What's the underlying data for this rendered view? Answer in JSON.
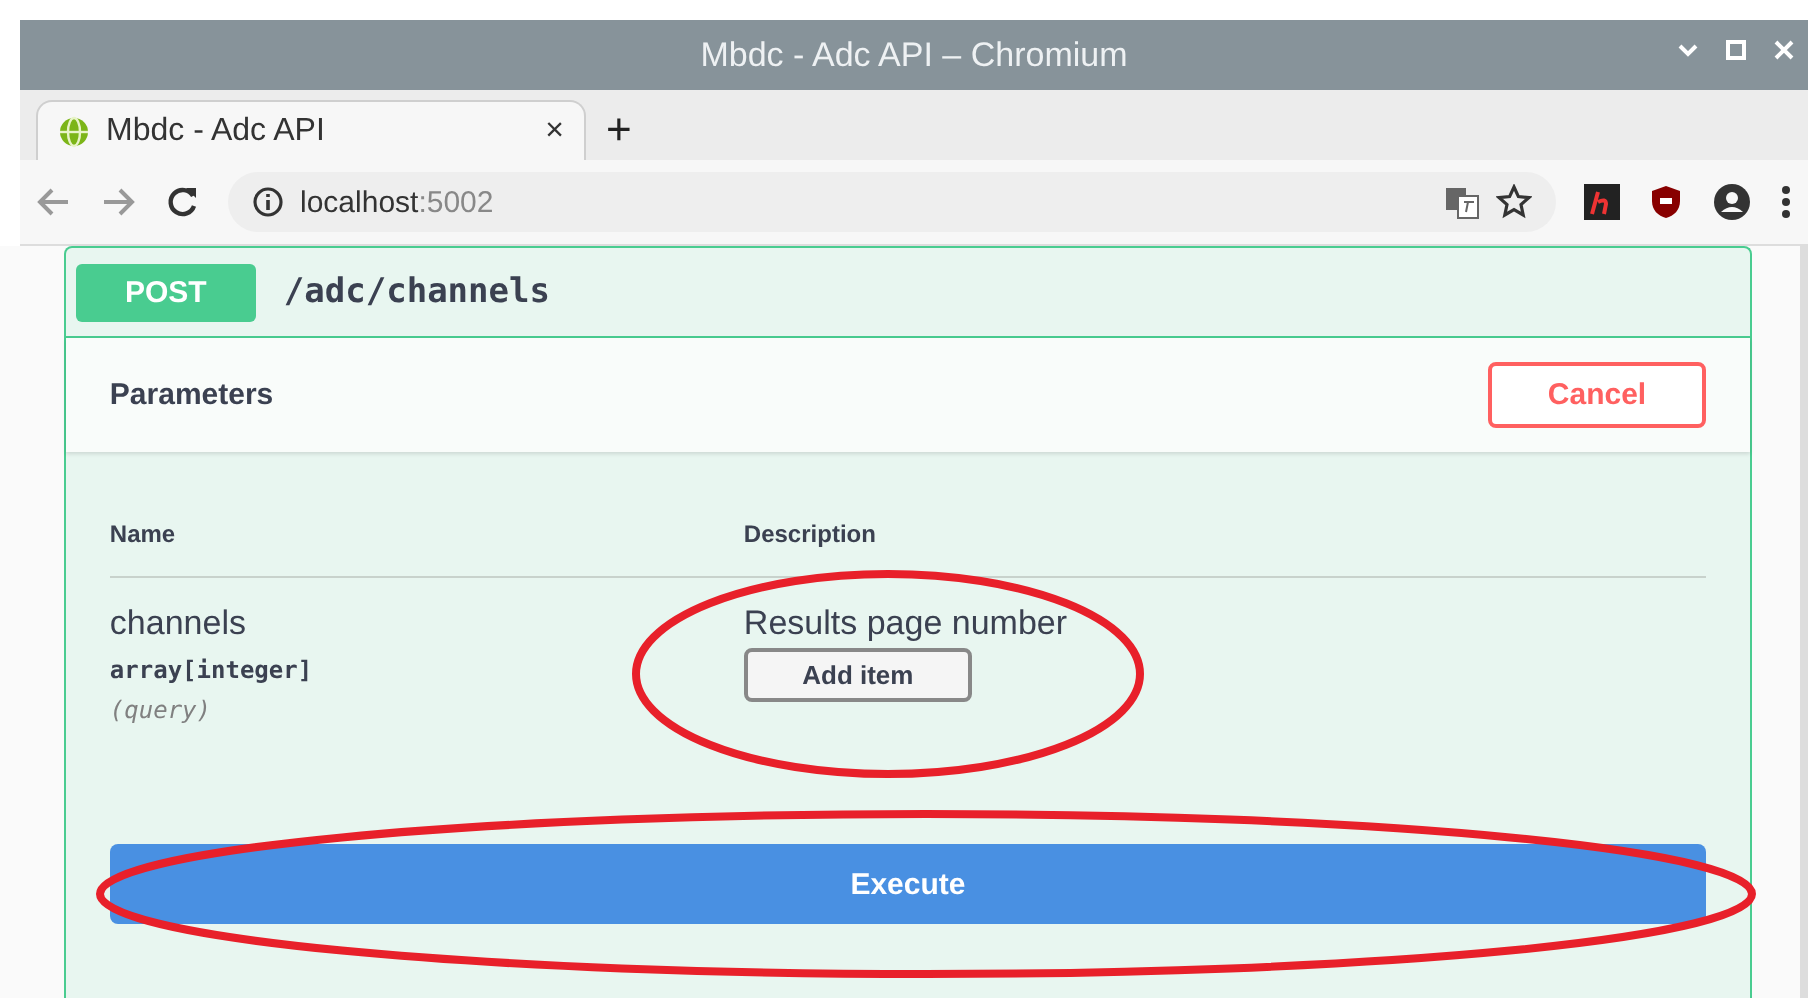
{
  "window": {
    "title": "Mbdc - Adc API – Chromium"
  },
  "tabs": [
    {
      "label": "Mbdc - Adc API",
      "close": "×",
      "selected": true
    }
  ],
  "new_tab": "+",
  "address_bar": {
    "host": "localhost",
    "port": ":5002"
  },
  "operation": {
    "method": "POST",
    "path": "/adc/channels"
  },
  "parameters": {
    "title": "Parameters",
    "cancel": "Cancel",
    "columns": [
      "Name",
      "Description"
    ],
    "rows": [
      {
        "name": "channels",
        "type": "array[integer]",
        "in": "(query)",
        "description": "Results page number",
        "button": "Add item"
      }
    ]
  },
  "execute": "Execute",
  "annotations": [
    {
      "kind": "ellipse"
    },
    {
      "kind": "ellipse"
    }
  ]
}
